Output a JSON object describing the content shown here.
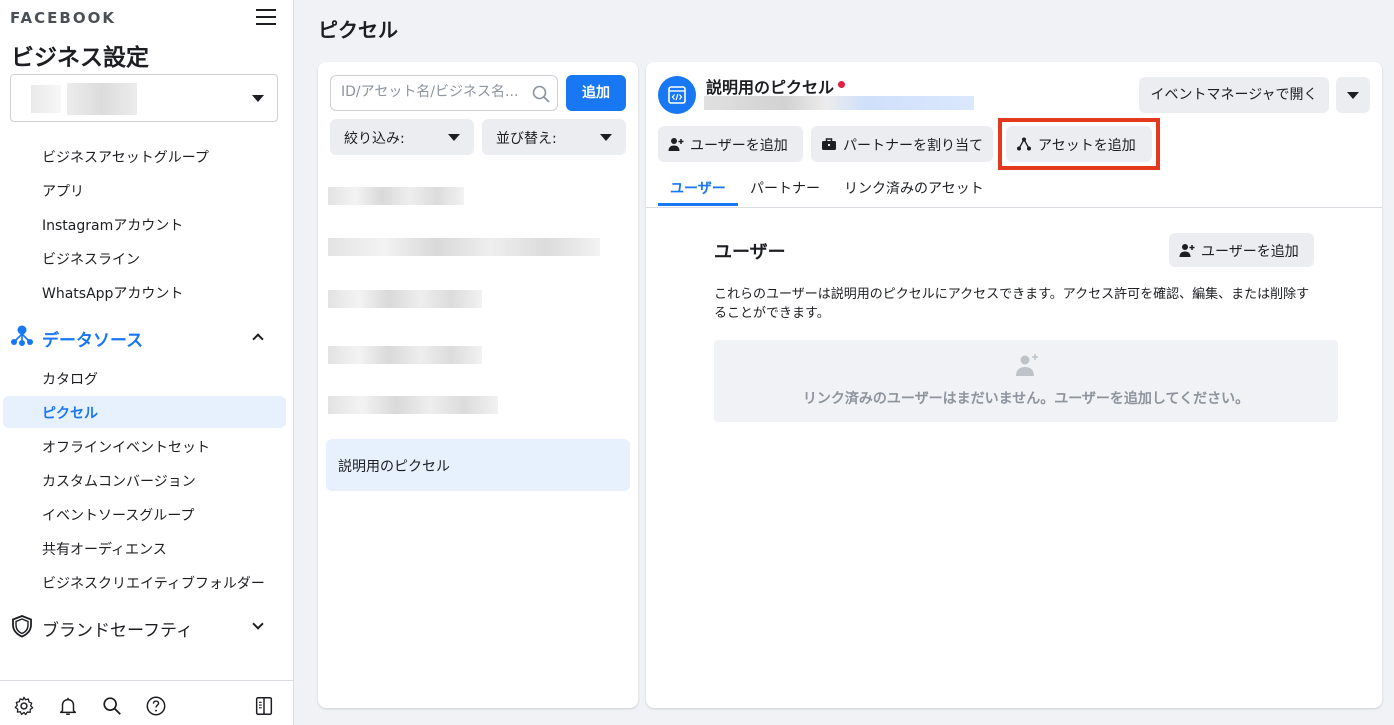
{
  "sidebar": {
    "brand": "FACEBOOK",
    "title": "ビジネス設定",
    "items_top": [
      "ビジネスアセットグループ",
      "アプリ",
      "Instagramアカウント",
      "ビジネスライン",
      "WhatsAppアカウント"
    ],
    "data_sources_label": "データソース",
    "data_sources_items": [
      "カタログ",
      "ピクセル",
      "オフラインイベントセット",
      "カスタムコンバージョン",
      "イベントソースグループ",
      "共有オーディエンス",
      "ビジネスクリエイティブフォルダー"
    ],
    "brand_safety_label": "ブランドセーフティ",
    "footer_icons": [
      "gear-icon",
      "bell-icon",
      "search-icon",
      "help-icon",
      "sidebar-toggle-icon"
    ]
  },
  "page": {
    "title": "ピクセル"
  },
  "list": {
    "search_placeholder": "ID/アセット名/ビジネス名...",
    "add_label": "追加",
    "filter_label": "絞り込み:",
    "sort_label": "並び替え:",
    "selected_item": "説明用のピクセル"
  },
  "detail": {
    "pixel_name": "説明用のピクセル",
    "status_color": "#e41e3f",
    "open_button": "イベントマネージャで開く",
    "actions": {
      "add_user": "ユーザーを追加",
      "assign_partner": "パートナーを割り当て",
      "add_asset": "アセットを追加"
    },
    "tabs": [
      "ユーザー",
      "パートナー",
      "リンク済みのアセット"
    ],
    "users_heading": "ユーザー",
    "users_add_button": "ユーザーを追加",
    "users_description": "これらのユーザーは説明用のピクセルにアクセスできます。アクセス許可を確認、編集、または削除することができます。",
    "empty_message": "リンク済みのユーザーはまだいません。ユーザーを追加してください。"
  },
  "colors": {
    "accent": "#1877f2",
    "highlight": "#e3391f"
  }
}
